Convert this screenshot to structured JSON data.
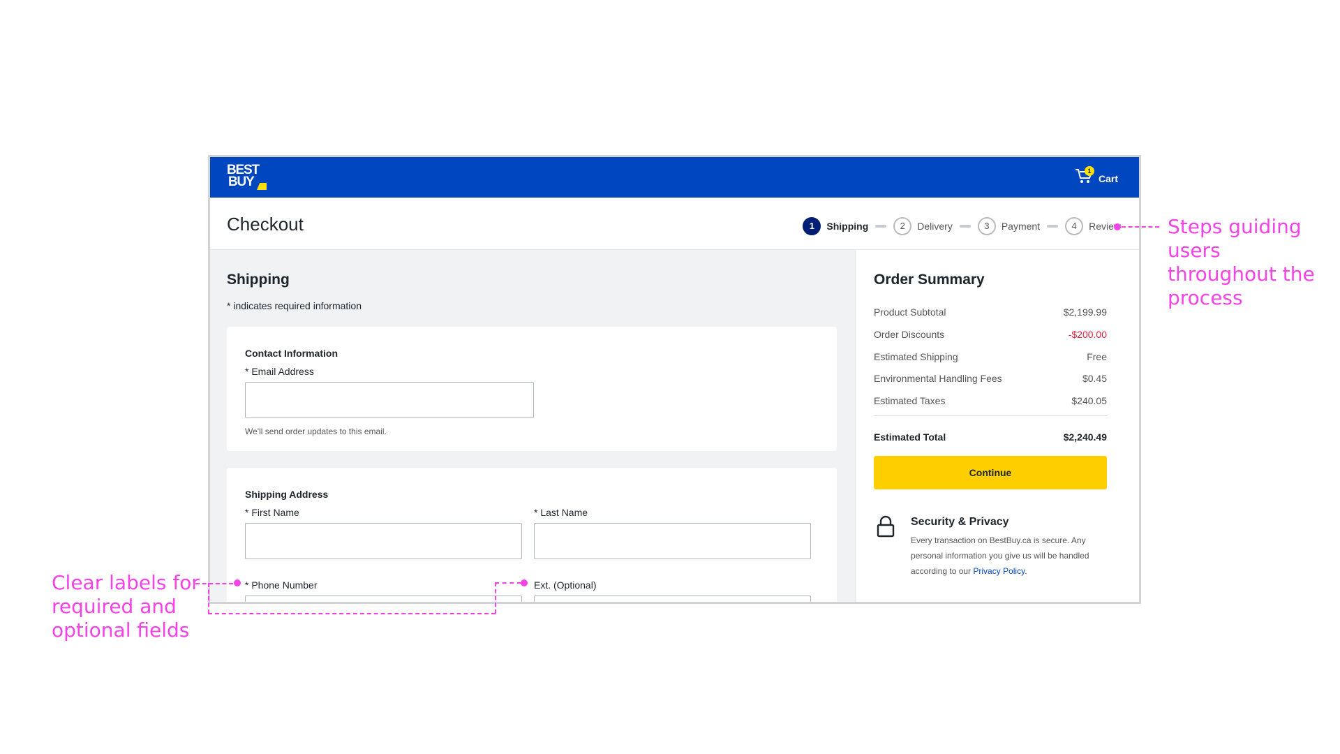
{
  "brand": {
    "logo_line1": "BEST",
    "logo_line2": "BUY"
  },
  "cart": {
    "label": "Cart",
    "count": "1"
  },
  "page": {
    "title": "Checkout"
  },
  "steps": [
    {
      "num": "1",
      "label": "Shipping",
      "active": true
    },
    {
      "num": "2",
      "label": "Delivery",
      "active": false
    },
    {
      "num": "3",
      "label": "Payment",
      "active": false
    },
    {
      "num": "4",
      "label": "Review",
      "active": false
    }
  ],
  "shipping": {
    "title": "Shipping",
    "required_note": "* indicates required information",
    "contact": {
      "title": "Contact Information",
      "email_label": "* Email Address",
      "email_value": "",
      "helper": "We'll send order updates to this email."
    },
    "address": {
      "title": "Shipping Address",
      "first_name_label": "* First Name",
      "last_name_label": "* Last Name",
      "phone_label": "* Phone Number",
      "ext_label": "Ext. (Optional)"
    }
  },
  "summary": {
    "title": "Order Summary",
    "rows": [
      {
        "label": "Product Subtotal",
        "value": "$2,199.99"
      },
      {
        "label": "Order Discounts",
        "value": "-$200.00"
      },
      {
        "label": "Estimated Shipping",
        "value": "Free"
      },
      {
        "label": "Environmental Handling Fees",
        "value": "$0.45"
      },
      {
        "label": "Estimated Taxes",
        "value": "$240.05"
      }
    ],
    "total_label": "Estimated Total",
    "total_value": "$2,240.49",
    "continue_label": "Continue",
    "security_title": "Security & Privacy",
    "security_text": "Every transaction on BestBuy.ca is secure. Any personal information you give us will be handled according to our ",
    "privacy_link": "Privacy Policy",
    "security_end": "."
  },
  "annotations": {
    "steps_note": "Steps guiding users throughout the process",
    "labels_note": "Clear labels for required and optional fields"
  },
  "colors": {
    "brand_blue": "#0046be",
    "accent_yellow": "#ffce00",
    "annotation": "#f542e6",
    "discount_red": "#e0203a"
  }
}
